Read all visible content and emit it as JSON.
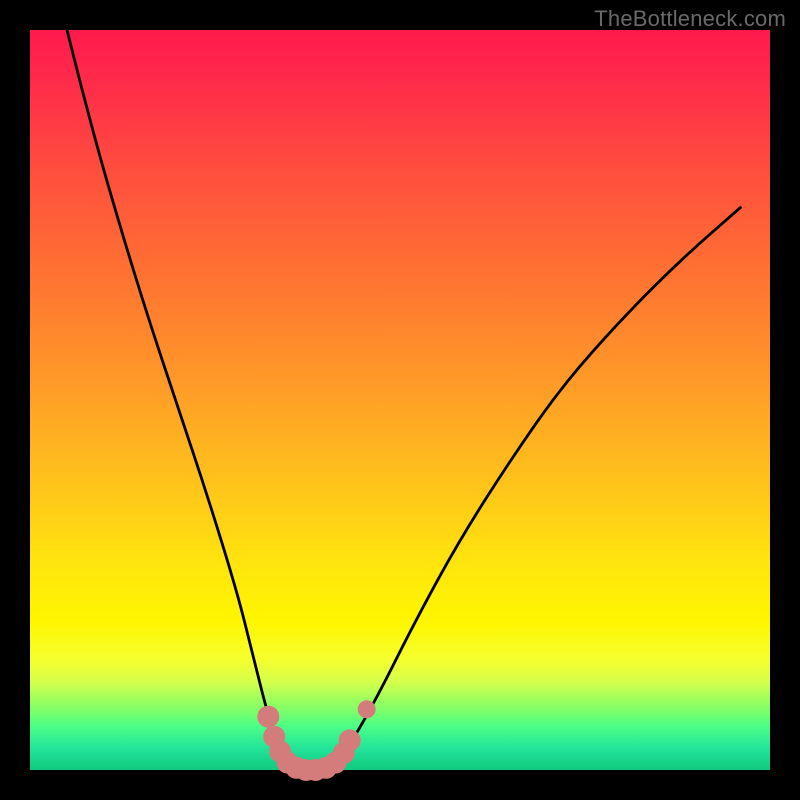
{
  "watermark": "TheBottleneck.com",
  "chart_data": {
    "type": "line",
    "title": "",
    "xlabel": "",
    "ylabel": "",
    "xlim": [
      0,
      100
    ],
    "ylim": [
      0,
      100
    ],
    "grid": false,
    "series": [
      {
        "name": "bottleneck-curve",
        "x": [
          5,
          8,
          12,
          16,
          20,
          24,
          28,
          30,
          32,
          33.5,
          35,
          37,
          39,
          41,
          43,
          47,
          52,
          58,
          65,
          72,
          80,
          88,
          96
        ],
        "y": [
          100,
          88,
          74,
          61,
          49,
          37,
          24,
          16,
          8,
          3,
          0.5,
          0,
          0,
          0.5,
          3,
          10,
          20,
          31,
          42,
          52,
          61,
          69,
          76
        ]
      }
    ],
    "highlight": {
      "name": "trough-highlight",
      "color": "#d47b7b",
      "points": [
        {
          "x": 32.2,
          "y": 7.2
        },
        {
          "x": 33.0,
          "y": 4.5
        },
        {
          "x": 33.8,
          "y": 2.5
        },
        {
          "x": 34.8,
          "y": 1.0
        },
        {
          "x": 36.0,
          "y": 0.3
        },
        {
          "x": 37.3,
          "y": 0.0
        },
        {
          "x": 38.6,
          "y": 0.0
        },
        {
          "x": 40.0,
          "y": 0.3
        },
        {
          "x": 41.3,
          "y": 1.0
        },
        {
          "x": 42.4,
          "y": 2.3
        },
        {
          "x": 43.2,
          "y": 4.0
        },
        {
          "x": 45.5,
          "y": 8.2
        }
      ]
    },
    "gradient_stops": [
      {
        "offset": 0,
        "color": "#ff1a4d"
      },
      {
        "offset": 30,
        "color": "#ff6a34"
      },
      {
        "offset": 62,
        "color": "#ffc51a"
      },
      {
        "offset": 80,
        "color": "#fff600"
      },
      {
        "offset": 94,
        "color": "#4dff86"
      },
      {
        "offset": 100,
        "color": "#10c97f"
      }
    ]
  }
}
